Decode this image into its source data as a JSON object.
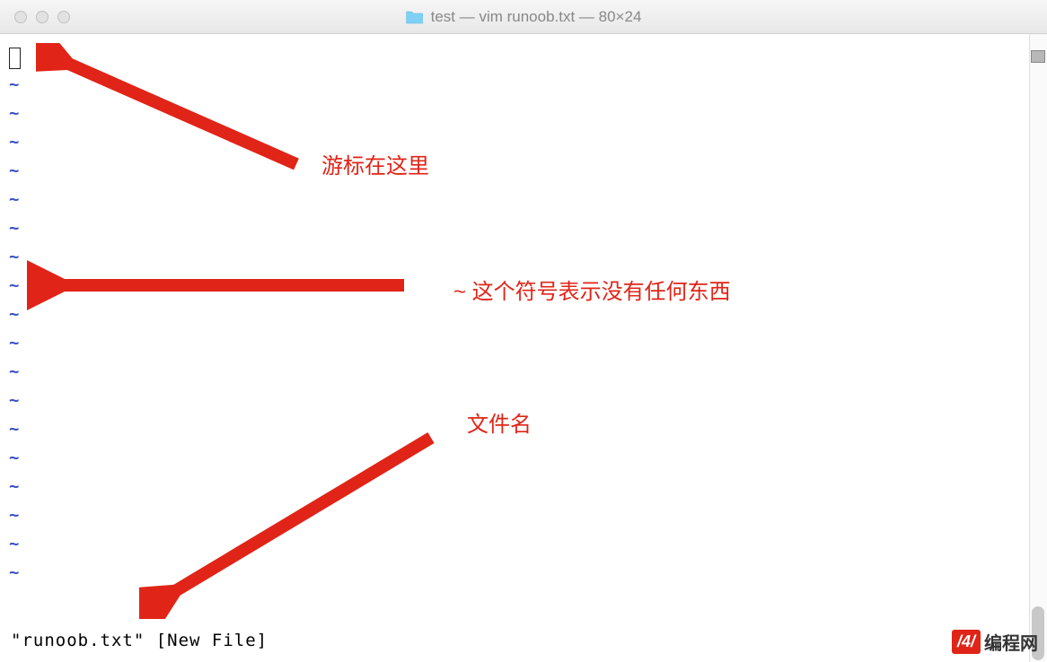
{
  "titlebar": {
    "title": "test — vim runoob.txt — 80×24"
  },
  "terminal": {
    "tilde_char": "~",
    "tilde_count": 18,
    "status_line": "\"runoob.txt\" [New File]"
  },
  "annotations": {
    "cursor_label": "游标在这里",
    "tilde_label": "~ 这个符号表示没有任何东西",
    "filename_label": "文件名"
  },
  "watermark": {
    "badge": "/4/",
    "text": "编程网"
  }
}
